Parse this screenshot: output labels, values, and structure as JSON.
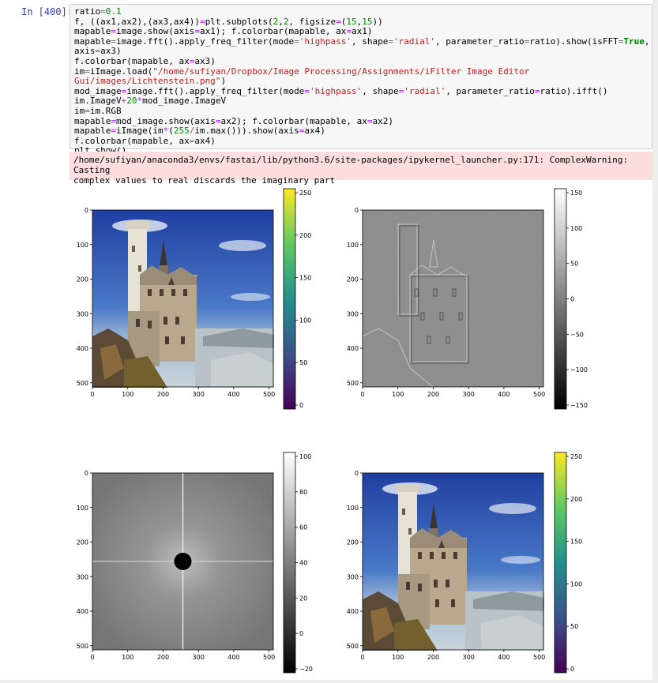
{
  "prompt": "In [400]:",
  "code_lines": [
    [
      {
        "t": "ratio"
      },
      {
        "t": "=",
        "c": "op"
      },
      {
        "t": "0.1",
        "c": "num"
      }
    ],
    [
      {
        "t": "f, ((ax1,ax2),(ax3,ax4))"
      },
      {
        "t": "=",
        "c": "op"
      },
      {
        "t": "plt.subplots("
      },
      {
        "t": "2",
        "c": "num"
      },
      {
        "t": ","
      },
      {
        "t": "2",
        "c": "num"
      },
      {
        "t": ", figsize"
      },
      {
        "t": "=",
        "c": "op"
      },
      {
        "t": "("
      },
      {
        "t": "15",
        "c": "num"
      },
      {
        "t": ","
      },
      {
        "t": "15",
        "c": "num"
      },
      {
        "t": "))"
      }
    ],
    [
      {
        "t": "mapable"
      },
      {
        "t": "=",
        "c": "op"
      },
      {
        "t": "image.show(axis"
      },
      {
        "t": "=",
        "c": "op"
      },
      {
        "t": "ax1); f.colorbar(mapable, ax"
      },
      {
        "t": "=",
        "c": "op"
      },
      {
        "t": "ax1)"
      }
    ],
    [
      {
        "t": "mapable"
      },
      {
        "t": "=",
        "c": "op"
      },
      {
        "t": "image.fft().apply_freq_filter(mode"
      },
      {
        "t": "=",
        "c": "op"
      },
      {
        "t": "'highpass'",
        "c": "str"
      },
      {
        "t": ", shape"
      },
      {
        "t": "=",
        "c": "op"
      },
      {
        "t": "'radial'",
        "c": "str"
      },
      {
        "t": ", parameter_ratio"
      },
      {
        "t": "=",
        "c": "op"
      },
      {
        "t": "ratio).show(isFFT"
      },
      {
        "t": "=",
        "c": "op"
      },
      {
        "t": "True",
        "c": "kw"
      },
      {
        "t": ","
      }
    ],
    [
      {
        "t": "axis"
      },
      {
        "t": "=",
        "c": "op"
      },
      {
        "t": "ax3)"
      }
    ],
    [
      {
        "t": "f.colorbar(mapable, ax"
      },
      {
        "t": "=",
        "c": "op"
      },
      {
        "t": "ax3)"
      }
    ],
    [
      {
        "t": "im"
      },
      {
        "t": "=",
        "c": "op"
      },
      {
        "t": "iImage.load("
      },
      {
        "t": "\"/home/sufiyan/Dropbox/Image Processing/Assignments/iFilter Image Editor",
        "c": "str"
      }
    ],
    [
      {
        "t": "Gui/images/Lichtenstein.png\"",
        "c": "str"
      },
      {
        "t": ")"
      }
    ],
    [
      {
        "t": "mod_image"
      },
      {
        "t": "=",
        "c": "op"
      },
      {
        "t": "image.fft().apply_freq_filter(mode"
      },
      {
        "t": "=",
        "c": "op"
      },
      {
        "t": "'highpass'",
        "c": "str"
      },
      {
        "t": ", shape"
      },
      {
        "t": "=",
        "c": "op"
      },
      {
        "t": "'radial'",
        "c": "str"
      },
      {
        "t": ", parameter_ratio"
      },
      {
        "t": "=",
        "c": "op"
      },
      {
        "t": "ratio).ifft()"
      }
    ],
    [
      {
        "t": "im.ImageV"
      },
      {
        "t": "+",
        "c": "op"
      },
      {
        "t": "20",
        "c": "num"
      },
      {
        "t": "*",
        "c": "op"
      },
      {
        "t": "mod_image.ImageV"
      }
    ],
    [
      {
        "t": "im"
      },
      {
        "t": "=",
        "c": "op"
      },
      {
        "t": "im.RGB"
      }
    ],
    [
      {
        "t": "mapable"
      },
      {
        "t": "=",
        "c": "op"
      },
      {
        "t": "mod_image.show(axis"
      },
      {
        "t": "=",
        "c": "op"
      },
      {
        "t": "ax2); f.colorbar(mapable, ax"
      },
      {
        "t": "=",
        "c": "op"
      },
      {
        "t": "ax2)"
      }
    ],
    [
      {
        "t": "mapable"
      },
      {
        "t": "=",
        "c": "op"
      },
      {
        "t": "iImage(im"
      },
      {
        "t": "*",
        "c": "op"
      },
      {
        "t": "("
      },
      {
        "t": "255",
        "c": "num"
      },
      {
        "t": "/",
        "c": "op"
      },
      {
        "t": "im.max())).show(axis"
      },
      {
        "t": "=",
        "c": "op"
      },
      {
        "t": "ax4)"
      }
    ],
    [
      {
        "t": "f.colorbar(mapable, ax"
      },
      {
        "t": "=",
        "c": "op"
      },
      {
        "t": "ax4)"
      }
    ],
    [
      {
        "t": "plt.show()"
      }
    ]
  ],
  "stderr": "/home/sufiyan/anaconda3/envs/fastai/lib/python3.6/site-packages/ipykernel_launcher.py:171: ComplexWarning: Casting\ncomplex values to real discards the imaginary part",
  "colors": {
    "prompt": "#303f9f",
    "string": "#ba2121",
    "number": "#008800",
    "keyword": "#008000",
    "stderr_bg": "#fddddd"
  },
  "plots": [
    {
      "name": "ax1",
      "kind": "castle",
      "yticks": [
        "0",
        "100",
        "200",
        "300",
        "400",
        "500"
      ],
      "xticks": [
        "0",
        "100",
        "200",
        "300",
        "400",
        "500"
      ],
      "colorbar": {
        "cmap": "viridis",
        "ticks": [
          "250",
          "200",
          "150",
          "100",
          "50",
          "0"
        ]
      }
    },
    {
      "name": "ax2",
      "kind": "highpass",
      "yticks": [
        "0",
        "100",
        "200",
        "300",
        "400",
        "500"
      ],
      "xticks": [
        "0",
        "100",
        "200",
        "300",
        "400",
        "500"
      ],
      "colorbar": {
        "cmap": "gray",
        "ticks": [
          "150",
          "100",
          "50",
          "0",
          "−50",
          "−100",
          "−150"
        ]
      }
    },
    {
      "name": "ax3",
      "kind": "fft",
      "yticks": [
        "0",
        "100",
        "200",
        "300",
        "400",
        "500"
      ],
      "xticks": [
        "0",
        "100",
        "200",
        "300",
        "400",
        "500"
      ],
      "colorbar": {
        "cmap": "gray",
        "ticks": [
          "100",
          "80",
          "60",
          "40",
          "20",
          "0",
          "−20"
        ]
      }
    },
    {
      "name": "ax4",
      "kind": "castle",
      "yticks": [
        "0",
        "100",
        "200",
        "300",
        "400",
        "500"
      ],
      "xticks": [
        "0",
        "100",
        "200",
        "300",
        "400",
        "500"
      ],
      "colorbar": {
        "cmap": "viridis",
        "ticks": [
          "250",
          "200",
          "150",
          "100",
          "50",
          "0"
        ]
      }
    }
  ]
}
